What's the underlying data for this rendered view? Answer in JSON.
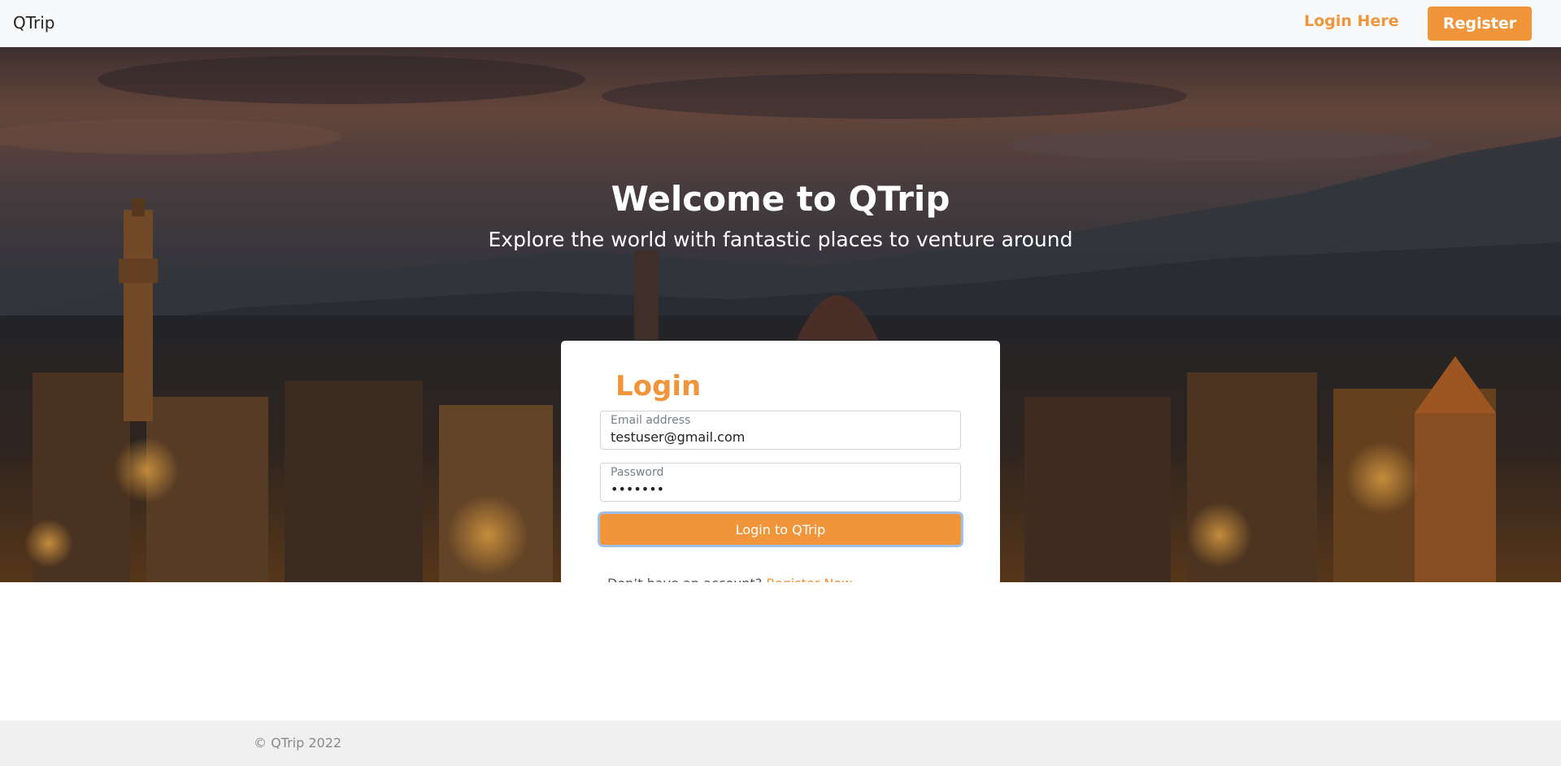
{
  "navbar": {
    "brand": "QTrip",
    "login_link": "Login Here",
    "register_button": "Register"
  },
  "hero": {
    "title": "Welcome to QTrip",
    "subtitle": "Explore the world with fantastic places to venture around"
  },
  "login_card": {
    "title": "Login",
    "email": {
      "label": "Email address",
      "value": "testuser@gmail.com"
    },
    "password": {
      "label": "Password",
      "value": "•••••••"
    },
    "submit_label": "Login to QTrip",
    "account_prompt": "Don’t have an account?",
    "register_link": "Register Now"
  },
  "footer": {
    "copyright": "© QTrip 2022"
  },
  "colors": {
    "accent": "#f0953a",
    "navbar_bg": "#f8f9fa",
    "footer_bg": "#f0f0f0"
  }
}
